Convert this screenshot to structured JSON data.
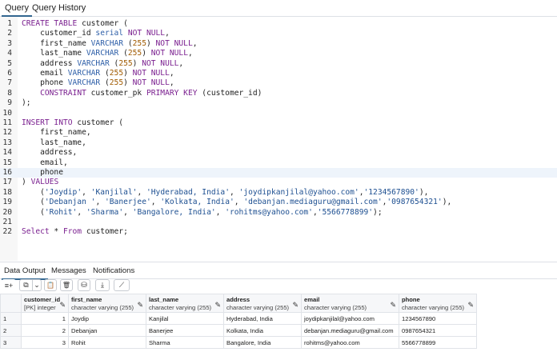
{
  "tabs": {
    "query": "Query",
    "history": "Query History"
  },
  "editor": {
    "lines": [
      {
        "n": "1",
        "tokens": [
          {
            "t": "CREATE TABLE",
            "c": "kw"
          },
          {
            "t": " customer (",
            "c": ""
          }
        ]
      },
      {
        "n": "2",
        "tokens": [
          {
            "t": "    customer_id ",
            "c": ""
          },
          {
            "t": "serial",
            "c": "ty"
          },
          {
            "t": " ",
            "c": ""
          },
          {
            "t": "NOT NULL",
            "c": "kw"
          },
          {
            "t": ",",
            "c": ""
          }
        ]
      },
      {
        "n": "3",
        "tokens": [
          {
            "t": "    first_name ",
            "c": ""
          },
          {
            "t": "VARCHAR",
            "c": "ty"
          },
          {
            "t": " (",
            "c": ""
          },
          {
            "t": "255",
            "c": "nm"
          },
          {
            "t": ") ",
            "c": ""
          },
          {
            "t": "NOT NULL",
            "c": "kw"
          },
          {
            "t": ",",
            "c": ""
          }
        ]
      },
      {
        "n": "4",
        "tokens": [
          {
            "t": "    last_name ",
            "c": ""
          },
          {
            "t": "VARCHAR",
            "c": "ty"
          },
          {
            "t": " (",
            "c": ""
          },
          {
            "t": "255",
            "c": "nm"
          },
          {
            "t": ") ",
            "c": ""
          },
          {
            "t": "NOT NULL",
            "c": "kw"
          },
          {
            "t": ",",
            "c": ""
          }
        ]
      },
      {
        "n": "5",
        "tokens": [
          {
            "t": "    address ",
            "c": ""
          },
          {
            "t": "VARCHAR",
            "c": "ty"
          },
          {
            "t": " (",
            "c": ""
          },
          {
            "t": "255",
            "c": "nm"
          },
          {
            "t": ") ",
            "c": ""
          },
          {
            "t": "NOT NULL",
            "c": "kw"
          },
          {
            "t": ",",
            "c": ""
          }
        ]
      },
      {
        "n": "6",
        "tokens": [
          {
            "t": "    email ",
            "c": ""
          },
          {
            "t": "VARCHAR",
            "c": "ty"
          },
          {
            "t": " (",
            "c": ""
          },
          {
            "t": "255",
            "c": "nm"
          },
          {
            "t": ") ",
            "c": ""
          },
          {
            "t": "NOT NULL",
            "c": "kw"
          },
          {
            "t": ",",
            "c": ""
          }
        ]
      },
      {
        "n": "7",
        "tokens": [
          {
            "t": "    phone ",
            "c": ""
          },
          {
            "t": "VARCHAR",
            "c": "ty"
          },
          {
            "t": " (",
            "c": ""
          },
          {
            "t": "255",
            "c": "nm"
          },
          {
            "t": ") ",
            "c": ""
          },
          {
            "t": "NOT NULL",
            "c": "kw"
          },
          {
            "t": ",",
            "c": ""
          }
        ]
      },
      {
        "n": "8",
        "tokens": [
          {
            "t": "    ",
            "c": ""
          },
          {
            "t": "CONSTRAINT",
            "c": "kw"
          },
          {
            "t": " customer_pk ",
            "c": ""
          },
          {
            "t": "PRIMARY KEY",
            "c": "kw"
          },
          {
            "t": " (customer_id)",
            "c": ""
          }
        ]
      },
      {
        "n": "9",
        "tokens": [
          {
            "t": ");",
            "c": ""
          }
        ]
      },
      {
        "n": "10",
        "tokens": []
      },
      {
        "n": "11",
        "tokens": [
          {
            "t": "INSERT INTO",
            "c": "kw"
          },
          {
            "t": " customer (",
            "c": ""
          }
        ]
      },
      {
        "n": "12",
        "tokens": [
          {
            "t": "    first_name,",
            "c": ""
          }
        ]
      },
      {
        "n": "13",
        "tokens": [
          {
            "t": "    last_name,",
            "c": ""
          }
        ]
      },
      {
        "n": "14",
        "tokens": [
          {
            "t": "    address,",
            "c": ""
          }
        ]
      },
      {
        "n": "15",
        "tokens": [
          {
            "t": "    email,",
            "c": ""
          }
        ]
      },
      {
        "n": "16",
        "current": true,
        "tokens": [
          {
            "t": "    phone",
            "c": ""
          }
        ]
      },
      {
        "n": "17",
        "tokens": [
          {
            "t": ") ",
            "c": ""
          },
          {
            "t": "VALUES",
            "c": "kw"
          }
        ]
      },
      {
        "n": "18",
        "tokens": [
          {
            "t": "    (",
            "c": ""
          },
          {
            "t": "'Joydip'",
            "c": "st"
          },
          {
            "t": ", ",
            "c": ""
          },
          {
            "t": "'Kanjilal'",
            "c": "st"
          },
          {
            "t": ", ",
            "c": ""
          },
          {
            "t": "'Hyderabad, India'",
            "c": "st"
          },
          {
            "t": ", ",
            "c": ""
          },
          {
            "t": "'joydipkanjilal@yahoo.com'",
            "c": "st"
          },
          {
            "t": ",",
            "c": ""
          },
          {
            "t": "'1234567890'",
            "c": "st"
          },
          {
            "t": "),",
            "c": ""
          }
        ]
      },
      {
        "n": "19",
        "tokens": [
          {
            "t": "    (",
            "c": ""
          },
          {
            "t": "'Debanjan '",
            "c": "st"
          },
          {
            "t": ", ",
            "c": ""
          },
          {
            "t": "'Banerjee'",
            "c": "st"
          },
          {
            "t": ", ",
            "c": ""
          },
          {
            "t": "'Kolkata, India'",
            "c": "st"
          },
          {
            "t": ", ",
            "c": ""
          },
          {
            "t": "'debanjan.mediaguru@gmail.com'",
            "c": "st"
          },
          {
            "t": ",",
            "c": ""
          },
          {
            "t": "'0987654321'",
            "c": "st"
          },
          {
            "t": "),",
            "c": ""
          }
        ]
      },
      {
        "n": "20",
        "tokens": [
          {
            "t": "    (",
            "c": ""
          },
          {
            "t": "'Rohit'",
            "c": "st"
          },
          {
            "t": ", ",
            "c": ""
          },
          {
            "t": "'Sharma'",
            "c": "st"
          },
          {
            "t": ", ",
            "c": ""
          },
          {
            "t": "'Bangalore, India'",
            "c": "st"
          },
          {
            "t": ", ",
            "c": ""
          },
          {
            "t": "'rohitms@yahoo.com'",
            "c": "st"
          },
          {
            "t": ",",
            "c": ""
          },
          {
            "t": "'5566778899'",
            "c": "st"
          },
          {
            "t": ");",
            "c": ""
          }
        ]
      },
      {
        "n": "21",
        "tokens": []
      },
      {
        "n": "22",
        "tokens": [
          {
            "t": "Select",
            "c": "kw"
          },
          {
            "t": " * ",
            "c": ""
          },
          {
            "t": "From",
            "c": "kw"
          },
          {
            "t": " customer;",
            "c": ""
          }
        ]
      }
    ]
  },
  "output_tabs": {
    "data_output": "Data Output",
    "messages": "Messages",
    "notifications": "Notifications"
  },
  "toolbar": {
    "add_row": "≡+",
    "copy": "⧉",
    "dropdown": "⌄",
    "paste": "📋",
    "delete": "🗑",
    "save": "⛁",
    "download": "⤓",
    "graph": "⟋"
  },
  "grid": {
    "columns": [
      {
        "name": "customer_id",
        "type": "[PK] integer"
      },
      {
        "name": "first_name",
        "type": "character varying (255)"
      },
      {
        "name": "last_name",
        "type": "character varying (255)"
      },
      {
        "name": "address",
        "type": "character varying (255)"
      },
      {
        "name": "email",
        "type": "character varying (255)"
      },
      {
        "name": "phone",
        "type": "character varying (255)"
      }
    ],
    "rows": [
      {
        "rn": "1",
        "customer_id": "1",
        "first_name": "Joydip",
        "last_name": "Kanjilal",
        "address": "Hyderabad, India",
        "email": "joydipkanjilal@yahoo.com",
        "phone": "1234567890"
      },
      {
        "rn": "2",
        "customer_id": "2",
        "first_name": "Debanjan",
        "last_name": "Banerjee",
        "address": "Kolkata, India",
        "email": "debanjan.mediaguru@gmail.com",
        "phone": "0987654321"
      },
      {
        "rn": "3",
        "customer_id": "3",
        "first_name": "Rohit",
        "last_name": "Sharma",
        "address": "Bangalore, India",
        "email": "rohitms@yahoo.com",
        "phone": "5566778899"
      }
    ],
    "edit_icon": "✎"
  }
}
